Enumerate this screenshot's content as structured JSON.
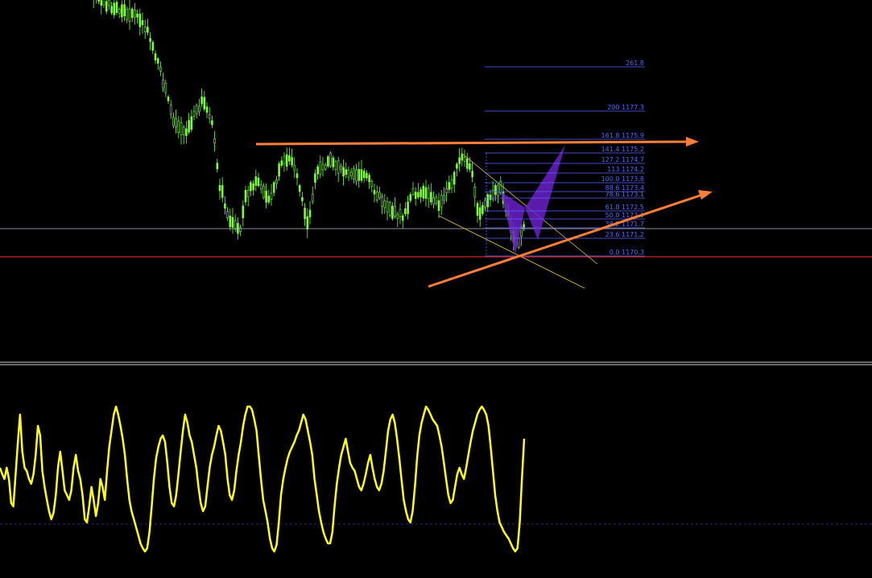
{
  "chart_data": [
    {
      "type": "candlestick",
      "panel": "price",
      "colors": {
        "up": "#7CFC3C",
        "down": "#7CFC3C",
        "background": "#000000"
      },
      "reference_lines": [
        {
          "name": "bid-line",
          "value": 1171.7,
          "color": "#B8B8C8"
        },
        {
          "name": "support-line",
          "value": 1170.3,
          "color": "#FF2A2A"
        }
      ],
      "fibonacci": {
        "color": "#5566FF",
        "levels": [
          {
            "ratio": "261.8",
            "price": ""
          },
          {
            "ratio": "200",
            "price": "1177.3"
          },
          {
            "ratio": "161.8",
            "price": "1175.9"
          },
          {
            "ratio": "141.4",
            "price": "1175.2"
          },
          {
            "ratio": "127.2",
            "price": "1174.7"
          },
          {
            "ratio": "113",
            "price": "1174.2"
          },
          {
            "ratio": "100.0",
            "price": "1173.8"
          },
          {
            "ratio": "88.6",
            "price": "1173.4"
          },
          {
            "ratio": "78.6",
            "price": "1173.1"
          },
          {
            "ratio": "61.8",
            "price": "1172.5"
          },
          {
            "ratio": "50.0",
            "price": "1172.1"
          },
          {
            "ratio": "38.2",
            "price": "1171.7"
          },
          {
            "ratio": "23.6",
            "price": "1171.2"
          },
          {
            "ratio": "0.0",
            "price": "1170.3"
          }
        ]
      },
      "annotations": {
        "trend_arrow_color": "#FF7F3A",
        "channel_color": "#E8C040",
        "pattern_color": "#6A1FC8"
      }
    },
    {
      "type": "line",
      "panel": "oscillator",
      "series": [
        {
          "color": "#FFFF1A",
          "values": [
            62,
            58,
            55,
            62,
            55,
            40,
            38,
            58,
            78,
            95,
            72,
            62,
            60,
            55,
            52,
            58,
            70,
            88,
            82,
            60,
            50,
            42,
            35,
            30,
            34,
            45,
            62,
            72,
            60,
            48,
            45,
            42,
            48,
            62,
            70,
            60,
            55,
            45,
            30,
            28,
            38,
            50,
            42,
            32,
            40,
            55,
            50,
            42,
            60,
            75,
            85,
            95,
            100,
            95,
            88,
            80,
            70,
            55,
            42,
            35,
            30,
            25,
            20,
            15,
            12,
            10,
            12,
            22,
            38,
            55,
            68,
            75,
            80,
            82,
            78,
            65,
            50,
            40,
            38,
            45,
            58,
            72,
            85,
            95,
            90,
            82,
            78,
            70,
            62,
            50,
            40,
            35,
            38,
            50,
            62,
            70,
            75,
            82,
            88,
            85,
            78,
            70,
            55,
            45,
            42,
            48,
            60,
            70,
            78,
            88,
            95,
            100,
            100,
            98,
            92,
            85,
            70,
            55,
            42,
            35,
            28,
            18,
            12,
            10,
            14,
            28,
            45,
            55,
            62,
            68,
            72,
            75,
            78,
            82,
            85,
            90,
            95,
            92,
            85,
            78,
            70,
            55,
            45,
            35,
            28,
            22,
            18,
            15,
            15,
            22,
            38,
            52,
            62,
            70,
            75,
            80,
            72,
            65,
            62,
            60,
            55,
            50,
            48,
            52,
            58,
            65,
            70,
            62,
            55,
            50,
            48,
            52,
            60,
            72,
            85,
            92,
            95,
            90,
            80,
            68,
            55,
            42,
            35,
            30,
            28,
            35,
            50,
            68,
            82,
            90,
            95,
            100,
            98,
            95,
            92,
            90,
            88,
            82,
            75,
            65,
            55,
            45,
            40,
            42,
            50,
            58,
            62,
            58,
            55,
            62,
            70,
            78,
            85,
            90,
            95,
            98,
            100,
            98,
            95,
            88,
            75,
            60,
            45,
            35,
            28,
            25,
            22,
            20,
            18,
            15,
            12,
            10,
            12,
            28,
            55,
            80
          ]
        }
      ],
      "reference_line": {
        "color": "#4A2AB0"
      }
    }
  ]
}
